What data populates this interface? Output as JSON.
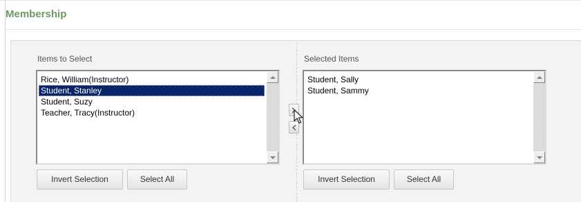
{
  "section": {
    "title": "Membership"
  },
  "available": {
    "label": "Items to Select",
    "items": [
      {
        "text": "Rice, William(Instructor)",
        "selected": false
      },
      {
        "text": "Student, Stanley",
        "selected": true
      },
      {
        "text": "Student, Suzy",
        "selected": false
      },
      {
        "text": "Teacher, Tracy(Instructor)",
        "selected": false
      }
    ],
    "invert_label": "Invert Selection",
    "select_all_label": "Select All"
  },
  "selected": {
    "label": "Selected Items",
    "items": [
      {
        "text": "Student, Sally",
        "selected": false
      },
      {
        "text": "Student, Sammy",
        "selected": false
      }
    ],
    "invert_label": "Invert Selection",
    "select_all_label": "Select All"
  },
  "move_controls": {
    "add_icon": "chevron-right-icon",
    "remove_icon": "chevron-left-icon"
  },
  "colors": {
    "title": "#6e9a62",
    "selection_bg": "#0a246a",
    "selection_fg": "#ffffff"
  }
}
